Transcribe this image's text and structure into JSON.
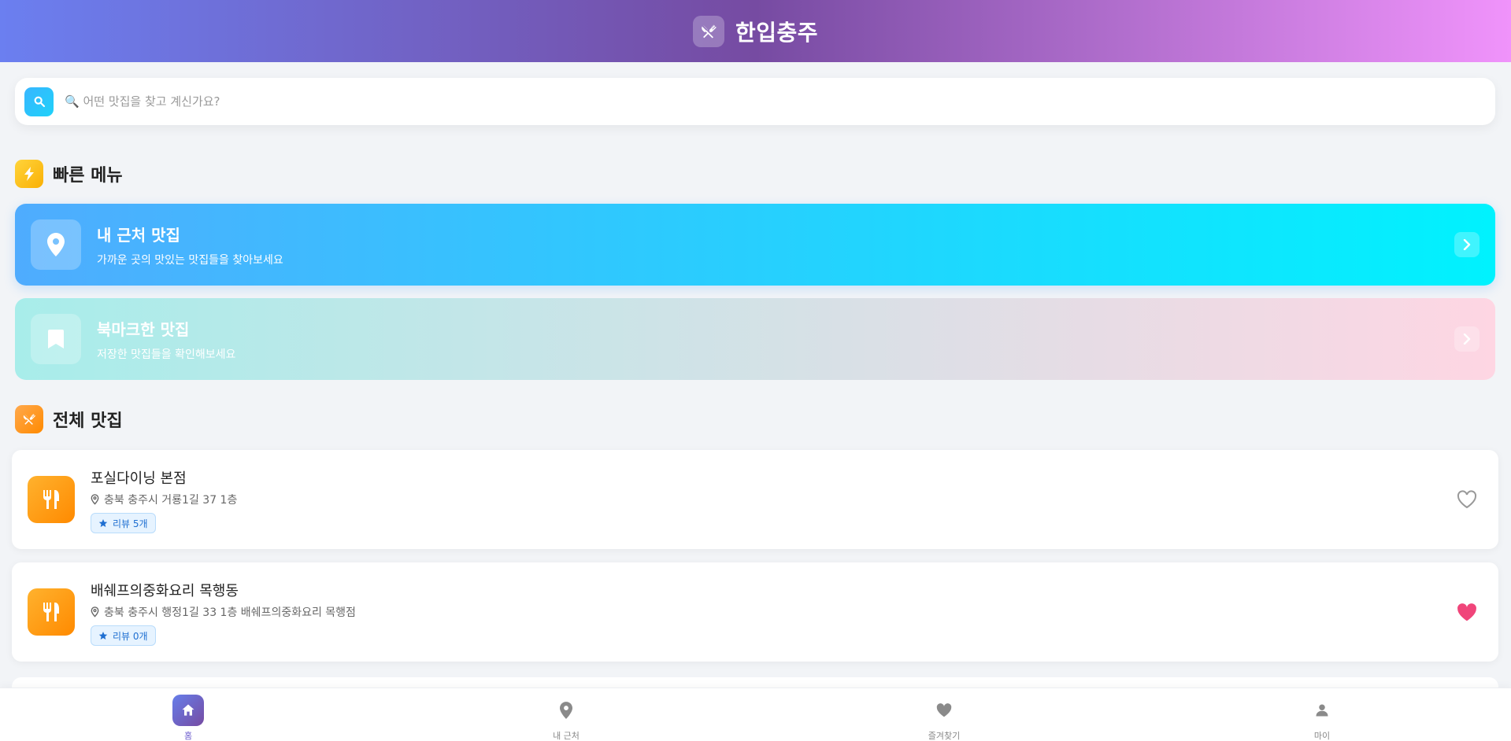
{
  "header": {
    "title": "한입충주",
    "logo_icon": "fork-knife-icon",
    "gradient": [
      "#667eea",
      "#764ba2",
      "#f093fb"
    ]
  },
  "search": {
    "placeholder": "🔍 어떤 맛집을 찾고 계신가요?",
    "value": "",
    "button_icon": "search-icon"
  },
  "quick_menu": {
    "title": "빠른 메뉴",
    "icon": "lightning-icon",
    "items": [
      {
        "title": "내 근처 맛집",
        "subtitle": "가까운 곳의 맛있는 맛집들을 찾아보세요",
        "icon": "map-pin-icon"
      },
      {
        "title": "북마크한 맛집",
        "subtitle": "저장한 맛집들을 확인해보세요",
        "icon": "bookmark-icon"
      }
    ]
  },
  "all_restaurants": {
    "title": "전체 맛집",
    "icon": "fork-knife-icon",
    "items": [
      {
        "name": "포실다이닝 본점",
        "address": "충북 충주시 거룡1길 37 1층",
        "review": "리뷰 5개",
        "favorited": false
      },
      {
        "name": "배쉐프의중화요리 목행동",
        "address": "충북 충주시 행정1길 33 1층 배쉐프의중화요리 목행점",
        "review": "리뷰 0개",
        "favorited": true
      }
    ]
  },
  "bottom_nav": {
    "items": [
      {
        "label": "홈",
        "icon": "home-icon",
        "active": true
      },
      {
        "label": "내 근처",
        "icon": "map-pin-icon",
        "active": false
      },
      {
        "label": "즐겨찾기",
        "icon": "heart-icon",
        "active": false
      },
      {
        "label": "마이",
        "icon": "user-icon",
        "active": false
      }
    ]
  },
  "colors": {
    "accent": "#667eea",
    "nearby_gradient": [
      "#4facfe",
      "#00f2fe"
    ],
    "bookmark_gradient": [
      "#a8edea",
      "#fed6e3"
    ],
    "restaurant_thumb": "#ff9a1a",
    "favorite": "#f0457a"
  }
}
